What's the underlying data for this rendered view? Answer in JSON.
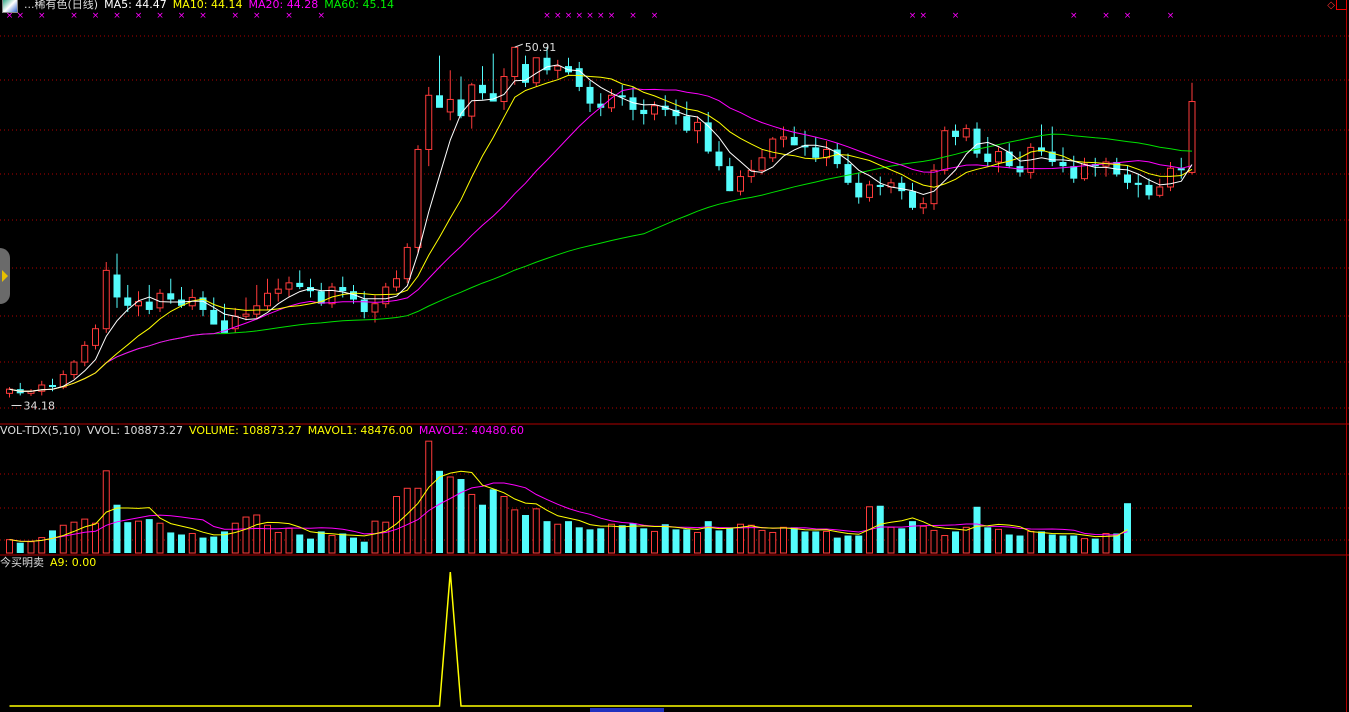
{
  "main_legend": {
    "name": "...稀有色(日线)",
    "ma5": "MA5: 44.47",
    "ma10": "MA10: 44.14",
    "ma20": "MA20: 44.28",
    "ma60": "MA60: 45.14"
  },
  "vol_legend": {
    "indicator": "VOL-TDX(5,10)",
    "vvol": "VVOL: 108873.27",
    "volume": "VOLUME: 108873.27",
    "mavol1": "MAVOL1: 48476.00",
    "mavol2": "MAVOL2: 40480.60"
  },
  "signal_legend": {
    "name": "今买明卖",
    "a9": "A9: 0.00"
  },
  "colors": {
    "up": "#ff3b3b",
    "down": "#54fcfc",
    "ma5": "#ffffff",
    "ma10": "#ffff00",
    "ma20": "#ff00ff",
    "ma60": "#00e000",
    "grid": "#b00000",
    "marker": "#ff00ff",
    "signal": "#ffff00"
  },
  "chart_data": {
    "type": "candlestick",
    "price_ylim": [
      33.5,
      52.5
    ],
    "high_label": "50.91",
    "low_label": "34.18",
    "ohlc": [
      [
        34.3,
        34.6,
        34.1,
        34.5
      ],
      [
        34.5,
        34.8,
        34.2,
        34.3
      ],
      [
        34.3,
        34.5,
        34.18,
        34.4
      ],
      [
        34.4,
        34.9,
        34.2,
        34.7
      ],
      [
        34.7,
        35.0,
        34.4,
        34.6
      ],
      [
        34.6,
        35.4,
        34.5,
        35.2
      ],
      [
        35.2,
        35.9,
        35.0,
        35.8
      ],
      [
        35.8,
        36.8,
        35.6,
        36.6
      ],
      [
        36.6,
        37.6,
        36.4,
        37.4
      ],
      [
        37.4,
        40.6,
        37.2,
        40.2
      ],
      [
        40.0,
        41.0,
        38.4,
        38.9
      ],
      [
        38.9,
        39.5,
        38.2,
        38.5
      ],
      [
        38.5,
        39.2,
        38.0,
        38.7
      ],
      [
        38.7,
        39.5,
        38.1,
        38.3
      ],
      [
        38.4,
        39.3,
        38.2,
        39.1
      ],
      [
        39.1,
        39.8,
        38.6,
        38.8
      ],
      [
        38.8,
        39.4,
        38.4,
        38.5
      ],
      [
        38.5,
        39.3,
        38.3,
        38.9
      ],
      [
        38.9,
        39.2,
        38.0,
        38.3
      ],
      [
        38.3,
        38.9,
        37.6,
        37.6
      ],
      [
        37.8,
        38.6,
        37.4,
        37.2
      ],
      [
        37.4,
        38.4,
        37.2,
        38.0
      ],
      [
        38.0,
        38.9,
        37.8,
        38.1
      ],
      [
        38.1,
        39.5,
        37.9,
        38.5
      ],
      [
        38.5,
        39.8,
        38.3,
        39.1
      ],
      [
        39.1,
        39.8,
        38.7,
        39.3
      ],
      [
        39.3,
        39.9,
        38.9,
        39.6
      ],
      [
        39.6,
        40.2,
        39.3,
        39.4
      ],
      [
        39.4,
        39.8,
        38.9,
        39.2
      ],
      [
        39.2,
        39.6,
        38.5,
        38.6
      ],
      [
        38.6,
        39.6,
        38.4,
        39.4
      ],
      [
        39.4,
        39.9,
        38.9,
        39.2
      ],
      [
        39.2,
        39.5,
        38.6,
        38.8
      ],
      [
        38.8,
        39.2,
        37.9,
        38.2
      ],
      [
        38.2,
        39.0,
        37.7,
        38.6
      ],
      [
        38.6,
        39.6,
        38.4,
        39.4
      ],
      [
        39.4,
        40.2,
        39.2,
        39.8
      ],
      [
        39.8,
        41.5,
        39.6,
        41.3
      ],
      [
        41.3,
        46.2,
        41.0,
        46.0
      ],
      [
        46.0,
        49.0,
        45.2,
        48.6
      ],
      [
        48.6,
        50.5,
        48.2,
        48.0
      ],
      [
        47.8,
        49.8,
        47.4,
        48.4
      ],
      [
        48.4,
        49.5,
        47.5,
        47.6
      ],
      [
        47.6,
        49.2,
        47.0,
        49.1
      ],
      [
        49.1,
        50.0,
        48.4,
        48.7
      ],
      [
        48.7,
        50.6,
        48.5,
        48.3
      ],
      [
        48.3,
        49.9,
        47.9,
        49.5
      ],
      [
        49.5,
        50.91,
        49.1,
        50.9
      ],
      [
        50.1,
        50.5,
        49.0,
        49.2
      ],
      [
        49.2,
        50.2,
        49.0,
        50.4
      ],
      [
        50.4,
        50.91,
        49.6,
        49.8
      ],
      [
        49.8,
        50.3,
        49.4,
        50.0
      ],
      [
        50.0,
        50.4,
        49.6,
        49.7
      ],
      [
        49.9,
        50.2,
        48.8,
        49.0
      ],
      [
        49.0,
        49.3,
        47.8,
        48.2
      ],
      [
        48.2,
        48.7,
        47.6,
        48.0
      ],
      [
        48.0,
        48.9,
        47.8,
        48.6
      ],
      [
        48.6,
        49.1,
        48.1,
        48.5
      ],
      [
        48.5,
        49.0,
        47.4,
        47.9
      ],
      [
        47.9,
        48.4,
        47.2,
        47.7
      ],
      [
        47.7,
        48.3,
        47.4,
        48.1
      ],
      [
        48.1,
        48.6,
        47.6,
        47.9
      ],
      [
        47.9,
        48.4,
        47.2,
        47.6
      ],
      [
        47.6,
        48.3,
        46.8,
        46.9
      ],
      [
        46.9,
        47.6,
        46.3,
        47.3
      ],
      [
        47.3,
        47.8,
        45.8,
        45.9
      ],
      [
        45.9,
        46.4,
        45.0,
        45.2
      ],
      [
        45.2,
        45.6,
        44.0,
        44.0
      ],
      [
        44.0,
        45.0,
        43.8,
        44.7
      ],
      [
        44.7,
        45.5,
        44.4,
        45.0
      ],
      [
        45.0,
        46.0,
        44.8,
        45.6
      ],
      [
        45.6,
        46.6,
        45.4,
        46.5
      ],
      [
        46.5,
        47.1,
        46.1,
        46.6
      ],
      [
        46.6,
        47.1,
        46.2,
        46.2
      ],
      [
        46.2,
        46.9,
        45.7,
        46.1
      ],
      [
        46.1,
        46.6,
        45.4,
        45.6
      ],
      [
        45.6,
        46.4,
        45.2,
        46.0
      ],
      [
        46.0,
        46.3,
        45.1,
        45.3
      ],
      [
        45.3,
        45.8,
        44.3,
        44.4
      ],
      [
        44.4,
        44.9,
        43.4,
        43.7
      ],
      [
        43.7,
        44.5,
        43.5,
        44.3
      ],
      [
        44.3,
        44.7,
        43.8,
        44.2
      ],
      [
        44.2,
        44.6,
        43.9,
        44.4
      ],
      [
        44.4,
        44.7,
        43.6,
        44.0
      ],
      [
        44.0,
        44.4,
        43.1,
        43.2
      ],
      [
        43.2,
        43.7,
        42.9,
        43.4
      ],
      [
        43.4,
        45.3,
        43.1,
        45.0
      ],
      [
        45.0,
        47.1,
        44.8,
        46.9
      ],
      [
        46.9,
        47.2,
        46.2,
        46.6
      ],
      [
        46.6,
        47.2,
        46.4,
        47.0
      ],
      [
        47.0,
        47.3,
        45.6,
        45.8
      ],
      [
        45.8,
        46.6,
        45.2,
        45.4
      ],
      [
        45.4,
        46.1,
        44.9,
        45.9
      ],
      [
        45.9,
        46.3,
        45.1,
        45.2
      ],
      [
        45.2,
        45.9,
        44.7,
        44.9
      ],
      [
        44.9,
        46.3,
        44.6,
        46.1
      ],
      [
        46.1,
        47.2,
        45.7,
        45.9
      ],
      [
        45.9,
        47.1,
        45.2,
        45.4
      ],
      [
        45.4,
        46.1,
        44.9,
        45.2
      ],
      [
        45.2,
        45.7,
        44.4,
        44.6
      ],
      [
        44.6,
        45.6,
        44.5,
        45.3
      ],
      [
        45.3,
        45.6,
        44.7,
        45.2
      ],
      [
        45.2,
        45.6,
        44.7,
        45.4
      ],
      [
        45.4,
        45.6,
        44.7,
        44.8
      ],
      [
        44.8,
        45.2,
        44.1,
        44.4
      ],
      [
        44.4,
        44.8,
        43.7,
        44.3
      ],
      [
        44.3,
        44.6,
        43.6,
        43.8
      ],
      [
        43.8,
        44.6,
        43.7,
        44.2
      ],
      [
        44.2,
        45.4,
        44.0,
        45.1
      ],
      [
        45.1,
        45.6,
        44.6,
        45.0
      ],
      [
        44.9,
        49.2,
        44.8,
        48.3
      ]
    ],
    "volume_ylim": [
      0,
      110000
    ],
    "volume": [
      13000,
      10000,
      11000,
      15000,
      22000,
      27000,
      30000,
      33000,
      29000,
      80000,
      47000,
      30000,
      31000,
      33000,
      29000,
      20000,
      18000,
      19000,
      15000,
      16000,
      21000,
      29000,
      35000,
      37000,
      27000,
      20000,
      24000,
      18000,
      14000,
      21000,
      17000,
      19000,
      15000,
      11000,
      31000,
      30000,
      55000,
      63000,
      63000,
      108873,
      80000,
      74000,
      72000,
      57000,
      47000,
      62000,
      55000,
      42000,
      37000,
      43000,
      31000,
      28000,
      31000,
      25000,
      23000,
      24000,
      28000,
      27000,
      29000,
      24000,
      21000,
      28000,
      23000,
      23000,
      20000,
      31000,
      22000,
      24000,
      28000,
      27000,
      22000,
      20000,
      25000,
      25000,
      21000,
      21000,
      21000,
      15000,
      17000,
      17000,
      45000,
      46000,
      25000,
      24000,
      31000,
      26000,
      22000,
      17000,
      21000,
      25000,
      45000,
      25000,
      23000,
      18000,
      17000,
      21000,
      21000,
      18000,
      17000,
      17000,
      14000,
      14000,
      19000,
      19000,
      48476
    ],
    "signal": [
      0,
      0,
      0,
      0,
      0,
      0,
      0,
      0,
      0,
      0,
      0,
      0,
      0,
      0,
      0,
      0,
      0,
      0,
      0,
      0,
      0,
      0,
      0,
      0,
      0,
      0,
      0,
      0,
      0,
      0,
      0,
      0,
      0,
      0,
      0,
      0,
      0,
      0,
      0,
      0,
      0,
      1,
      0,
      0,
      0,
      0,
      0,
      0,
      0,
      0,
      0,
      0,
      0,
      0,
      0,
      0,
      0,
      0,
      0,
      0,
      0,
      0,
      0,
      0,
      0,
      0,
      0,
      0,
      0,
      0,
      0,
      0,
      0,
      0,
      0,
      0,
      0,
      0,
      0,
      0,
      0,
      0,
      0,
      0,
      0,
      0,
      0,
      0,
      0,
      0,
      0,
      0,
      0,
      0,
      0,
      0,
      0,
      0,
      0,
      0,
      0,
      0,
      0,
      0,
      0,
      0,
      0,
      0,
      0,
      0,
      0
    ],
    "marker_bars": [
      0,
      1,
      3,
      6,
      8,
      10,
      12,
      14,
      16,
      18,
      21,
      23,
      26,
      29,
      50,
      51,
      52,
      53,
      54,
      55,
      56,
      58,
      60,
      84,
      85,
      88,
      99,
      102,
      104,
      108,
      112,
      115,
      120,
      124,
      129
    ]
  }
}
